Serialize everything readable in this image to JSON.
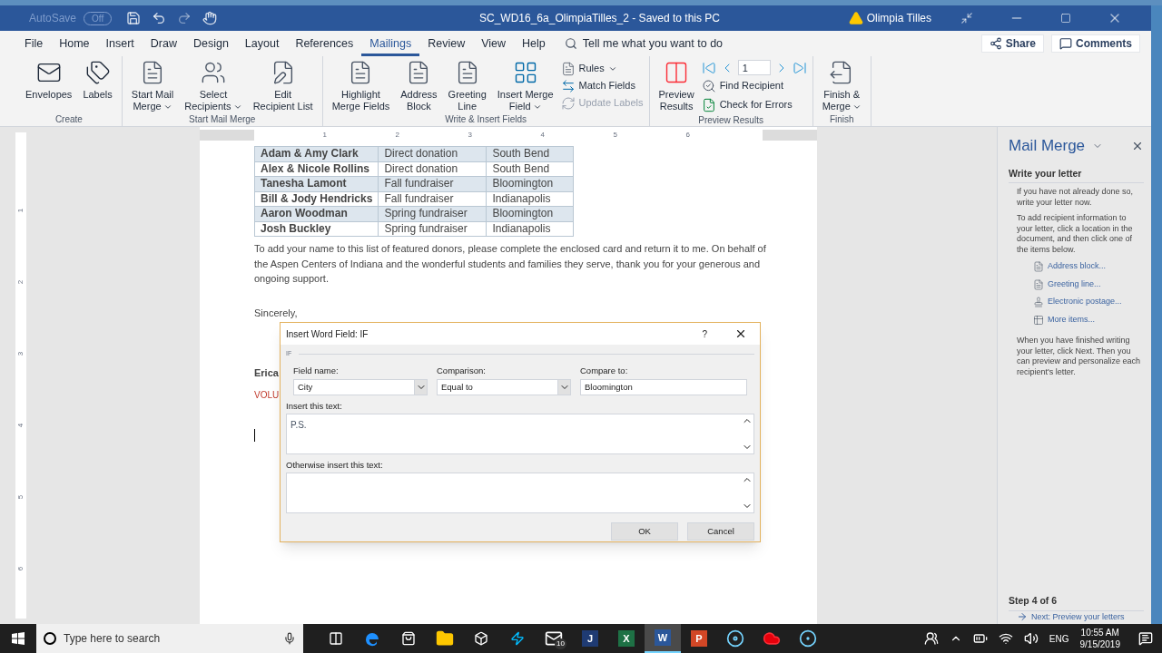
{
  "window": {
    "autosave": "AutoSave",
    "autosave_state": "Off",
    "title": "SC_WD16_6a_OlimpiaTilles_2  -  Saved to this PC",
    "user": "Olimpia Tilles"
  },
  "menu_tabs": [
    {
      "label": "File",
      "selected": false
    },
    {
      "label": "Home",
      "selected": false
    },
    {
      "label": "Insert",
      "selected": false
    },
    {
      "label": "Draw",
      "selected": false
    },
    {
      "label": "Design",
      "selected": false
    },
    {
      "label": "Layout",
      "selected": false
    },
    {
      "label": "References",
      "selected": false
    },
    {
      "label": "Mailings",
      "selected": true
    },
    {
      "label": "Review",
      "selected": false
    },
    {
      "label": "View",
      "selected": false
    },
    {
      "label": "Help",
      "selected": false
    }
  ],
  "tell_me": "Tell me what you want to do",
  "share": "Share",
  "comments": "Comments",
  "ribbon_groups": [
    {
      "label": "Create",
      "items": [
        {
          "kind": "large",
          "lines": [
            "Envelopes"
          ],
          "dropdown": false,
          "disabled": false
        },
        {
          "kind": "large",
          "lines": [
            "Labels"
          ],
          "dropdown": false,
          "disabled": false
        }
      ]
    },
    {
      "label": "Start Mail Merge",
      "items": [
        {
          "kind": "large",
          "lines": [
            "Start Mail",
            "Merge"
          ],
          "dropdown": true,
          "disabled": false
        },
        {
          "kind": "large",
          "lines": [
            "Select",
            "Recipients"
          ],
          "dropdown": true,
          "disabled": false
        },
        {
          "kind": "large",
          "lines": [
            "Edit",
            "Recipient List"
          ],
          "dropdown": false,
          "disabled": false
        }
      ]
    },
    {
      "label": "Write & Insert Fields",
      "items": [
        {
          "kind": "large",
          "lines": [
            "Highlight",
            "Merge Fields"
          ],
          "dropdown": false,
          "disabled": false
        },
        {
          "kind": "large",
          "lines": [
            "Address",
            "Block"
          ],
          "dropdown": false,
          "disabled": false
        },
        {
          "kind": "large",
          "lines": [
            "Greeting",
            "Line"
          ],
          "dropdown": false,
          "disabled": false
        },
        {
          "kind": "large",
          "lines": [
            "Insert Merge",
            "Field"
          ],
          "dropdown": true,
          "disabled": false
        },
        {
          "kind": "stack",
          "entries": [
            {
              "label": "Rules",
              "dropdown": true,
              "disabled": false
            },
            {
              "label": "Match Fields",
              "dropdown": false,
              "disabled": false
            },
            {
              "label": "Update Labels",
              "dropdown": false,
              "disabled": true
            }
          ]
        }
      ]
    },
    {
      "label": "Preview Results",
      "items": [
        {
          "kind": "large",
          "lines": [
            "Preview",
            "Results"
          ],
          "dropdown": false,
          "disabled": false
        },
        {
          "kind": "navstack",
          "record": "1",
          "entries": [
            {
              "label": "Find Recipient",
              "dropdown": false,
              "disabled": false
            },
            {
              "label": "Check for Errors",
              "dropdown": false,
              "disabled": false
            }
          ]
        }
      ]
    },
    {
      "label": "Finish",
      "items": [
        {
          "kind": "large",
          "lines": [
            "Finish &",
            "Merge"
          ],
          "dropdown": true,
          "disabled": false
        }
      ]
    }
  ],
  "ruler": [
    "1",
    "2",
    "3",
    "4",
    "5",
    "6"
  ],
  "vertical_ruler": [
    "1",
    "2",
    "3",
    "4",
    "5",
    "6"
  ],
  "document": {
    "table": [
      [
        "Adam & Amy Clark",
        "Direct donation",
        "South Bend"
      ],
      [
        "Alex & Nicole Rollins",
        "Direct donation",
        "South Bend"
      ],
      [
        "Tanesha Lamont",
        "Fall fundraiser",
        "Bloomington"
      ],
      [
        "Bill & Jody Hendricks",
        "Fall fundraiser",
        "Indianapolis"
      ],
      [
        "Aaron Woodman",
        "Spring fundraiser",
        "Bloomington"
      ],
      [
        "Josh Buckley",
        "Spring fundraiser",
        "Indianapolis"
      ]
    ],
    "paragraph": "To add your name to this list of featured donors, please complete the enclosed card and return it to me. On behalf of the Aspen Centers of Indiana and the wonderful students and families they serve, thank you for your generous and ongoing support.",
    "closing": "Sincerely,",
    "signer": "Erica",
    "signer_title": "VOLU"
  },
  "dialog": {
    "title": "Insert Word Field: IF",
    "help": "?",
    "section": "IF",
    "field_name_label": "Field name:",
    "field_name": "City",
    "comparison_label": "Comparison:",
    "comparison": "Equal to",
    "compare_to_label": "Compare to:",
    "compare_to": "Bloomington",
    "insert_label": "Insert this text:",
    "insert_text": "P.S.",
    "otherwise_label": "Otherwise insert this text:",
    "ok": "OK",
    "cancel": "Cancel"
  },
  "pane": {
    "title": "Mail Merge",
    "heading": "Write your letter",
    "intro": "If you have not already done so, write your letter now.",
    "instructions": "To add recipient information to your letter, click a location in the document, and then click one of the items below.",
    "links": [
      "Address block...",
      "Greeting line...",
      "Electronic postage...",
      "More items..."
    ],
    "outro": "When you have finished writing your letter, click Next. Then you can preview and personalize each recipient's letter.",
    "step": "Step 4 of 6",
    "next": "Next: Preview your letters"
  },
  "taskbar": {
    "search_placeholder": "Type here to search",
    "apps": [
      {
        "kind": "taskview",
        "selected": false
      },
      {
        "kind": "edge",
        "selected": false
      },
      {
        "kind": "store",
        "selected": false
      },
      {
        "kind": "folder",
        "selected": false
      },
      {
        "kind": "dropbox",
        "selected": false
      },
      {
        "kind": "bolt",
        "selected": false
      },
      {
        "kind": "mail",
        "badge": "10",
        "selected": false
      },
      {
        "kind": "glyph",
        "glyph": "J",
        "color": "#1f3b73",
        "selected": false
      },
      {
        "kind": "glyph",
        "glyph": "X",
        "color": "#1e7145",
        "selected": false
      },
      {
        "kind": "glyph",
        "glyph": "W",
        "color": "#2b579a",
        "selected": true
      },
      {
        "kind": "glyph",
        "glyph": "P",
        "color": "#d24726",
        "selected": false
      },
      {
        "kind": "disc",
        "selected": false
      },
      {
        "kind": "cloud",
        "selected": false
      },
      {
        "kind": "ring",
        "selected": false
      }
    ],
    "language": "ENG",
    "time": "10:55 AM",
    "date": "9/15/2019"
  }
}
